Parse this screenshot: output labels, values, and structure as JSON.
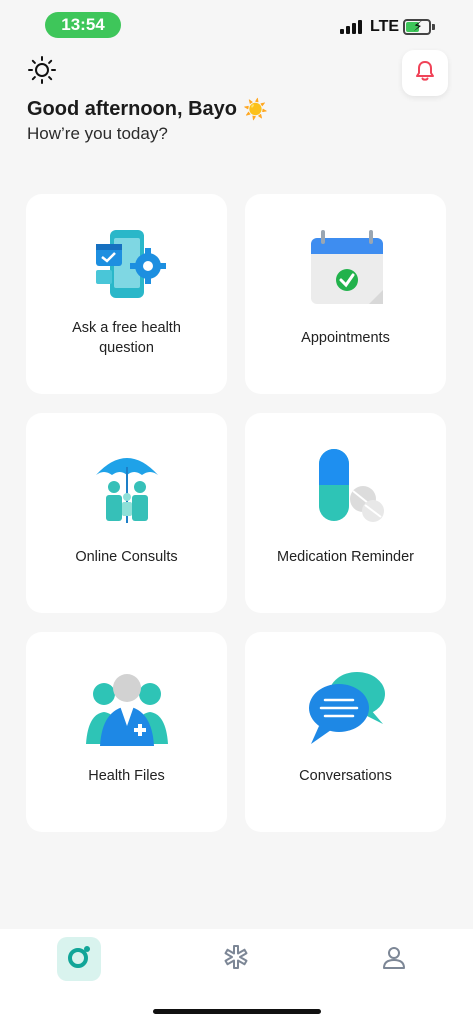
{
  "status_bar": {
    "time": "13:54",
    "network": "LTE",
    "battery_level": 0.6,
    "charging": true
  },
  "header": {
    "greeting": "Good afternoon, Bayo",
    "greeting_emoji": "☀️",
    "subtitle": "How’re you today?",
    "theme_icon": "sun-icon",
    "notification_icon": "bell-icon"
  },
  "cards": [
    {
      "label": "Ask a free health question",
      "icon": "phone-gear-illustration"
    },
    {
      "label": "Appointments",
      "icon": "calendar-check-illustration"
    },
    {
      "label": "Online Consults",
      "icon": "umbrella-family-illustration"
    },
    {
      "label": "Medication Reminder",
      "icon": "pills-illustration"
    },
    {
      "label": "Health Files",
      "icon": "doctor-illustration"
    },
    {
      "label": "Conversations",
      "icon": "chat-bubbles-illustration"
    }
  ],
  "tab_bar": {
    "tabs": [
      {
        "name": "home",
        "icon": "home-ring-icon",
        "active": true
      },
      {
        "name": "health",
        "icon": "medical-star-icon",
        "active": false
      },
      {
        "name": "profile",
        "icon": "user-icon",
        "active": false
      }
    ]
  },
  "colors": {
    "accent": "#1cb7a8",
    "status_green": "#3ec65a",
    "bell_red": "#f04358",
    "background": "#f6f6f6"
  }
}
